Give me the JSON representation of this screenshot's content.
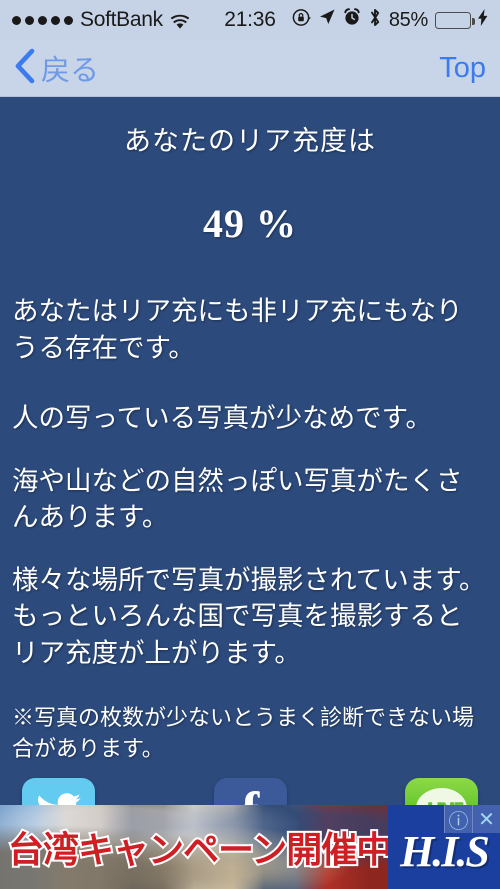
{
  "status_bar": {
    "signal_dots": 5,
    "carrier": "SoftBank",
    "wifi_icon": "wifi-icon",
    "time": "21:36",
    "rotation_lock_icon": "rotation-lock-icon",
    "location_icon": "location-arrow-icon",
    "alarm_icon": "alarm-clock-icon",
    "bluetooth_icon": "bluetooth-icon",
    "battery_percent": "85%",
    "battery_level": 85,
    "charging_icon": "lightning-bolt-icon"
  },
  "navbar": {
    "back_icon": "chevron-left-icon",
    "back_label": "戻る",
    "top_label": "Top",
    "background": "#c8d4e8",
    "tint": "#3b7bf0"
  },
  "result": {
    "title": "あなたのリア充度は",
    "percent": "49 %",
    "percent_value": 49,
    "background": "#2c4a7c",
    "text_color": "#ffffff"
  },
  "paragraphs": [
    "あなたはリア充にも非リア充にもなりうる存在です。",
    "人の写っている写真が少なめです。",
    "海や山などの自然っぽい写真がたくさんあります。",
    "様々な場所で写真が撮影されています。もっといろんな国で写真を撮影するとリア充度が上がります。"
  ],
  "note": "※写真の枚数が少ないとうまく診断できない場合があります。",
  "social": [
    {
      "name": "twitter",
      "label": "Twitter",
      "icon": "twitter-bird-icon",
      "color": "#63caf0"
    },
    {
      "name": "facebook",
      "label": "Facebook",
      "icon": "facebook-f-icon",
      "color": "#3c5a99"
    },
    {
      "name": "line",
      "label": "LINE",
      "icon": "line-bubble-icon",
      "bubble_text": "LINE",
      "color": "#57c120"
    }
  ],
  "ad": {
    "headline": "台湾キャンペーン開催中!",
    "brand": "H.I.S",
    "info_icon": "info-circle-icon",
    "close_icon": "close-icon",
    "brand_background": "#1a3f9e",
    "headline_color": "#cf1f24"
  }
}
